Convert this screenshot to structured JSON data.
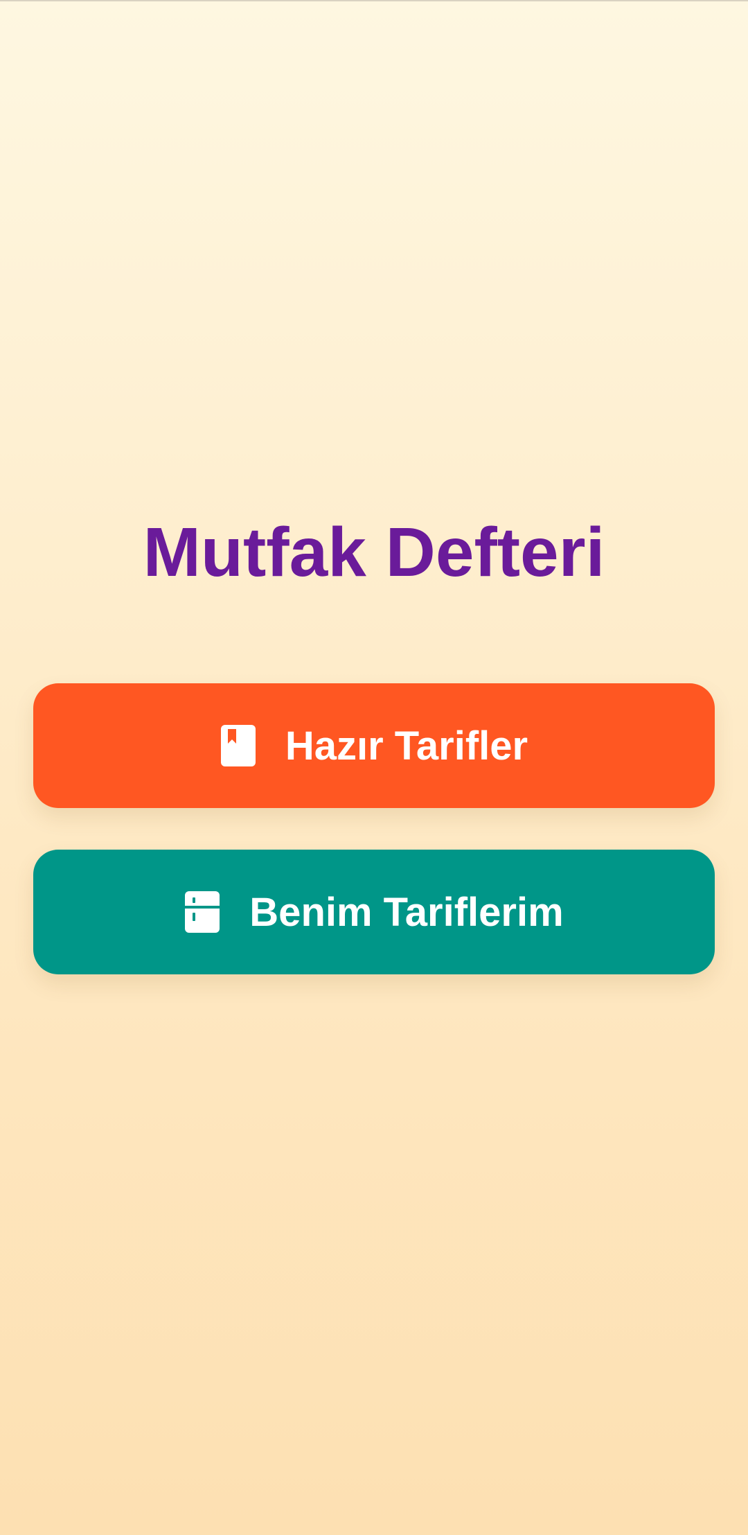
{
  "app": {
    "title": "Mutfak Defteri"
  },
  "buttons": [
    {
      "label": "Hazır Tarifler",
      "icon": "book-bookmark-icon",
      "color": "#ff5722"
    },
    {
      "label": "Benim Tariflerim",
      "icon": "fridge-icon",
      "color": "#009688"
    }
  ],
  "colors": {
    "title": "#6a1b9a",
    "background_top": "#fef7e1",
    "background_bottom": "#fde0b2",
    "button_text": "#ffffff"
  }
}
